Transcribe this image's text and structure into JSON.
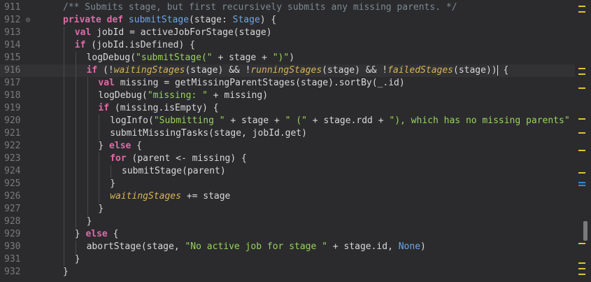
{
  "editor": {
    "current_line": "916",
    "lines": [
      {
        "n": "911",
        "indent": 1,
        "html": "<span class=\"cm\">/** Submits stage, but first recursively submits any missing parents. */</span>"
      },
      {
        "n": "912",
        "indent": 1,
        "marker": true,
        "html": "<span class=\"kw\">private def</span> <span class=\"fn\">submitStage</span>(stage: <span class=\"ty\">Stage</span>) {"
      },
      {
        "n": "913",
        "indent": 2,
        "html": "<span class=\"kw\">val</span> jobId = activeJobForStage(stage)"
      },
      {
        "n": "914",
        "indent": 2,
        "html": "<span class=\"kw\">if</span> (jobId.isDefined) {"
      },
      {
        "n": "915",
        "indent": 3,
        "html": "logDebug(<span class=\"str\">\"submitStage(\"</span> + stage + <span class=\"str\">\")\"</span>)"
      },
      {
        "n": "916",
        "indent": 3,
        "html": "<span class=\"kw\">if</span> (!<span class=\"it\">waitingStages</span>(stage) &amp;&amp; !<span class=\"it\">runningStages</span>(stage) &amp;&amp; !<span class=\"it\">failedStages</span>(stage))<span class=\"caret\"></span> {"
      },
      {
        "n": "917",
        "indent": 4,
        "html": "<span class=\"kw\">val</span> missing = getMissingParentStages(stage).sortBy(_.id)"
      },
      {
        "n": "918",
        "indent": 4,
        "html": "logDebug(<span class=\"str\">\"missing: \"</span> + missing)"
      },
      {
        "n": "919",
        "indent": 4,
        "html": "<span class=\"kw\">if</span> (missing.isEmpty) {"
      },
      {
        "n": "920",
        "indent": 5,
        "html": "logInfo(<span class=\"str\">\"Submitting \"</span> + stage + <span class=\"str\">\" (\"</span> + stage.rdd + <span class=\"str\">\"), which has no missing parents\"</span>"
      },
      {
        "n": "921",
        "indent": 5,
        "html": "submitMissingTasks(stage, jobId.get)"
      },
      {
        "n": "922",
        "indent": 4,
        "html": "} <span class=\"kw\">else</span> {"
      },
      {
        "n": "923",
        "indent": 5,
        "html": "<span class=\"kw\">for</span> (parent &lt;- missing) {"
      },
      {
        "n": "924",
        "indent": 6,
        "html": "submitStage(parent)"
      },
      {
        "n": "925",
        "indent": 5,
        "html": "}"
      },
      {
        "n": "926",
        "indent": 5,
        "html": "<span class=\"it\">waitingStages</span> += stage"
      },
      {
        "n": "927",
        "indent": 4,
        "html": "}"
      },
      {
        "n": "928",
        "indent": 3,
        "html": "}"
      },
      {
        "n": "929",
        "indent": 2,
        "html": "} <span class=\"kw\">else</span> {"
      },
      {
        "n": "930",
        "indent": 3,
        "html": "abortStage(stage, <span class=\"str\">\"No active job for stage \"</span> + stage.id, <span class=\"none\">None</span>)"
      },
      {
        "n": "931",
        "indent": 2,
        "html": "}"
      },
      {
        "n": "932",
        "indent": 1,
        "html": "}"
      }
    ]
  },
  "colors": {
    "background": "#2b2b2d",
    "keyword": "#e06aa8",
    "function": "#6fa6e8",
    "string": "#98d35c",
    "comment": "#7d8a93",
    "field_italic": "#d8b55a"
  },
  "scrollbar": {
    "marks": [
      {
        "color": "yellow",
        "pos": 0.02
      },
      {
        "color": "yellow",
        "pos": 0.04
      },
      {
        "color": "yellow",
        "pos": 0.24
      },
      {
        "color": "yellow",
        "pos": 0.26
      },
      {
        "color": "yellow",
        "pos": 0.31
      },
      {
        "color": "yellow",
        "pos": 0.42
      },
      {
        "color": "yellow",
        "pos": 0.47
      },
      {
        "color": "yellow",
        "pos": 0.53
      },
      {
        "color": "yellow",
        "pos": 0.61
      },
      {
        "color": "blue",
        "pos": 0.645
      },
      {
        "color": "blue",
        "pos": 0.655
      },
      {
        "color": "yellow",
        "pos": 0.86
      },
      {
        "color": "yellow",
        "pos": 0.93
      },
      {
        "color": "yellow",
        "pos": 0.95
      },
      {
        "color": "yellow",
        "pos": 0.97
      }
    ]
  }
}
